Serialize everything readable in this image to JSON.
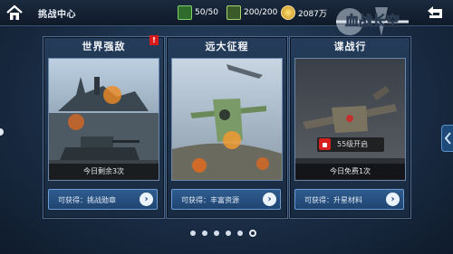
{
  "topbar": {
    "title": "挑战中心",
    "resource1": "50/50",
    "resource2": "200/200",
    "resource3": "2087万",
    "logo_text": "血战长空"
  },
  "cards": [
    {
      "title": "世界强敌",
      "status": "今日剩余3次",
      "reward": "可获得：挑战勋章",
      "badge": "!"
    },
    {
      "title": "远大征程",
      "status": "",
      "reward": "可获得：丰富资源"
    },
    {
      "title": "谍战行",
      "status": "今日免费1次",
      "reward": "可获得：升星材料",
      "lock_text": "55级开启"
    }
  ],
  "colors": {
    "accent": "#2f5c8e",
    "alert": "#d81b1b"
  },
  "pagination": {
    "total": 6,
    "current": 6
  }
}
